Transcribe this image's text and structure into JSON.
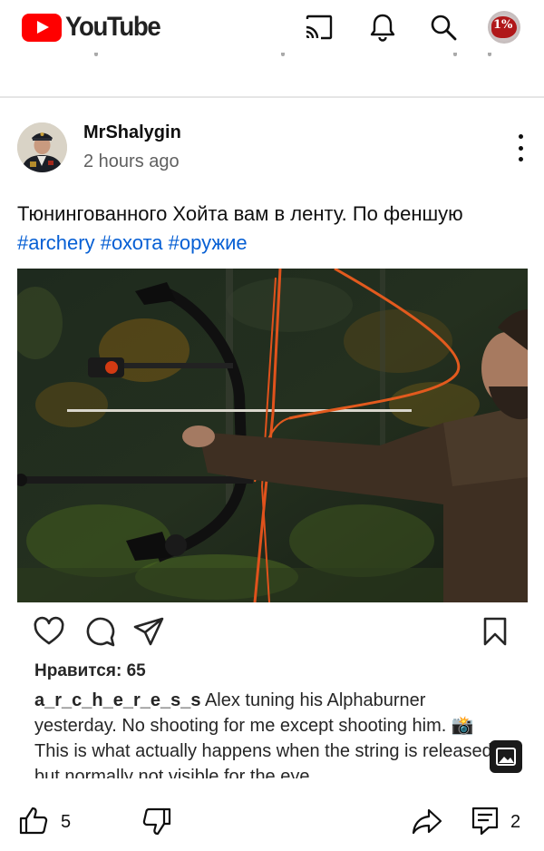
{
  "header": {
    "logo_text": "YouTube",
    "avatar_badge": "1%"
  },
  "post": {
    "author": "MrShalygin",
    "time": "2 hours ago",
    "text_plain": "Тюнингованного Хойта вам в ленту. По феншую ",
    "hashtags": [
      "#archery",
      "#охота",
      "#оружие"
    ]
  },
  "embed": {
    "likes": "Нравится: 65",
    "caption_user": "a_r_c_h_e_r_e_s_s",
    "caption_text": " Alex tuning his Alphaburner yesterday. No shooting for me except shooting him. 📸 This is what actually happens when the string is released, but normally not visible for the eye."
  },
  "actions": {
    "like_count": "5",
    "comment_count": "2"
  },
  "colors": {
    "brand_red": "#ff0000",
    "hashtag_blue": "#065fd4",
    "text_primary": "#0f0f0f",
    "text_secondary": "#606060"
  },
  "icons": {
    "top": [
      "cast-icon",
      "bell-icon",
      "search-icon"
    ],
    "embed": [
      "heart-icon",
      "comment-icon",
      "send-icon",
      "bookmark-icon",
      "image-icon"
    ],
    "bottom": [
      "thumb-up-icon",
      "thumb-down-icon",
      "share-icon",
      "comment-icon"
    ]
  }
}
